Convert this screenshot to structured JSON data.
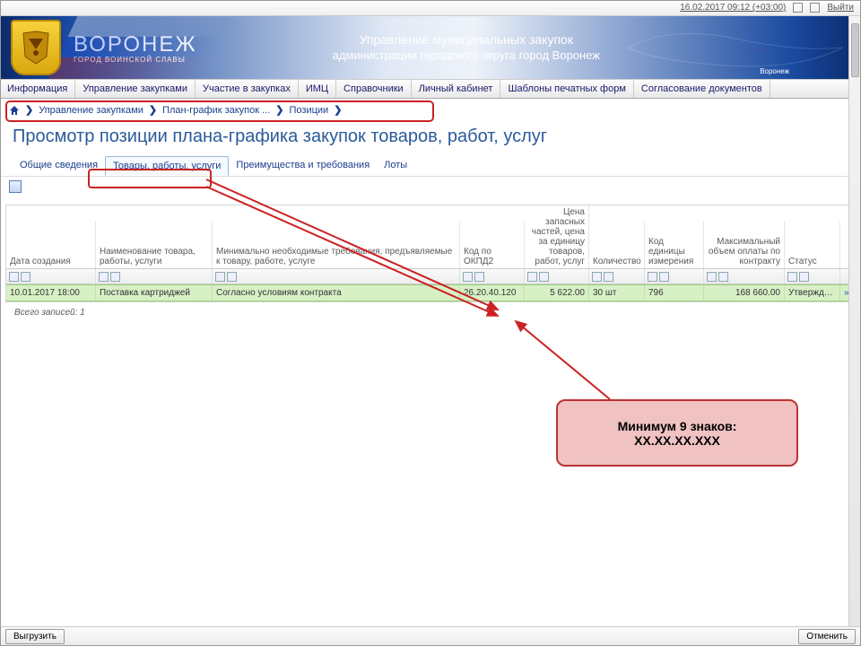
{
  "topbar": {
    "timestamp": "16.02.2017 09:12 (+03:00)",
    "logout": "Выйти"
  },
  "brand": {
    "city": "ВОРОНЕЖ",
    "slogan": "ГОРОД ВОИНСКОЙ СЛАВЫ",
    "dept1": "Управление муниципальных закупок",
    "dept2": "администрации городского округа город Воронеж",
    "map_label": "Воронеж"
  },
  "nav": {
    "items": [
      "Информация",
      "Управление закупками",
      "Участие в закупках",
      "ИМЦ",
      "Справочники",
      "Личный кабинет",
      "Шаблоны печатных форм",
      "Согласование документов"
    ]
  },
  "breadcrumbs": [
    "Управление закупками",
    "План-график закупок ...",
    "Позиции"
  ],
  "page_title": "Просмотр позиции плана-графика закупок товаров, работ, услуг",
  "tabs": [
    "Общие сведения",
    "Товары, работы, услуги",
    "Преимущества и требования",
    "Лоты"
  ],
  "grid": {
    "headers": {
      "c1": "Дата создания",
      "c2": "Наименование товара, работы, услуги",
      "c3": "Минимально необходимые требования, предъявляемые к товару, работе, услуге",
      "c4": "Код по ОКПД2",
      "c5": "Цена запасных частей, цена за единицу товаров, работ, услуг",
      "c6": "Количество",
      "c7": "Код единицы измерения",
      "c8": "Максимальный объем оплаты по контракту",
      "c9": "Статус"
    },
    "row": {
      "c1": "10.01.2017 18:00",
      "c2": "Поставка картриджей",
      "c3": "Согласно условиям контракта",
      "c4": "26.20.40.120",
      "c5": "5 622.00",
      "c6": "30 шт",
      "c7": "796",
      "c8": "168 660.00",
      "c9": "Утверждена"
    },
    "total": "Всего записей: 1"
  },
  "callout": {
    "l1": "Минимум 9 знаков:",
    "l2": "XX.XX.XX.XXX"
  },
  "footer": {
    "export": "Выгрузить",
    "cancel": "Отменить"
  }
}
